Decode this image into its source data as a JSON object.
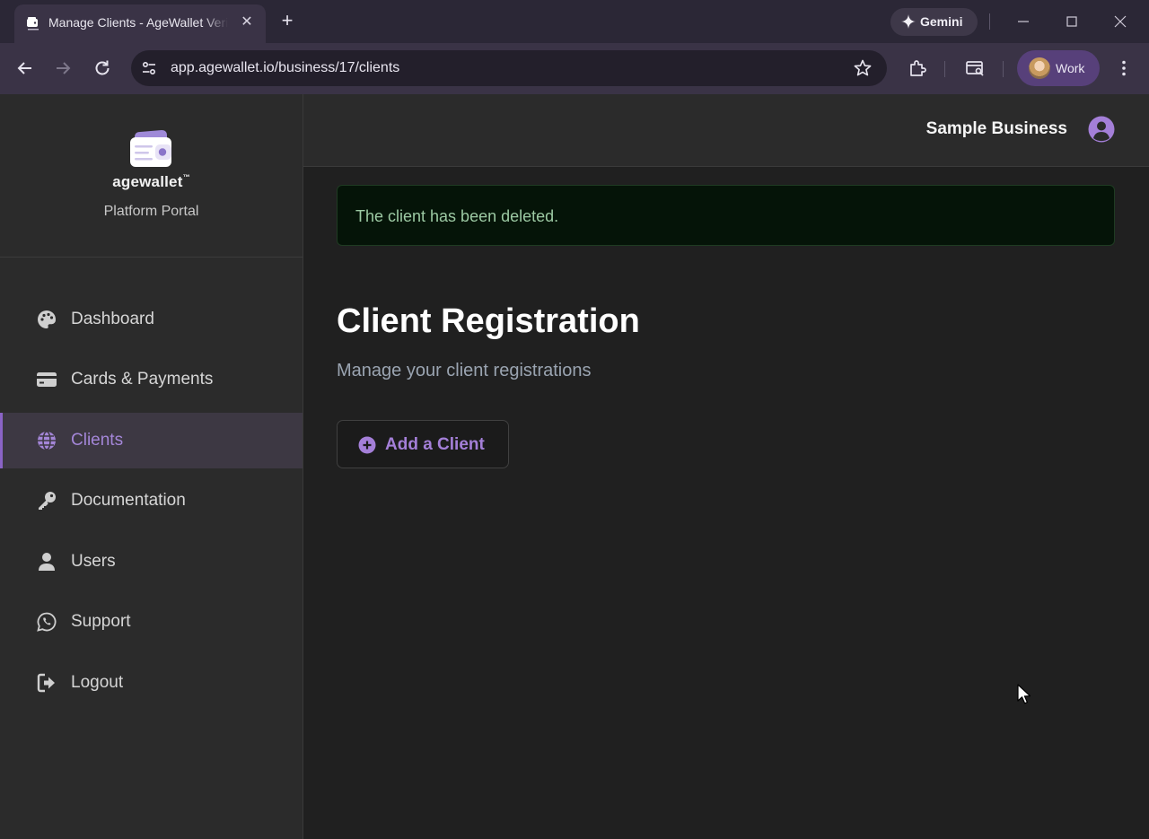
{
  "browser": {
    "tab_title": "Manage Clients - AgeWallet Verification",
    "close_tab": "✕",
    "new_tab": "+",
    "gemini_label": "Gemini",
    "url": "app.agewallet.io/business/17/clients",
    "profile_label": "Work"
  },
  "sidebar": {
    "brand_name": "agewallet",
    "brand_tm": "™",
    "brand_subtitle": "Platform Portal",
    "items": [
      {
        "label": "Dashboard",
        "icon": "palette-icon",
        "active": false
      },
      {
        "label": "Cards & Payments",
        "icon": "credit-card-icon",
        "active": false
      },
      {
        "label": "Clients",
        "icon": "globe-icon",
        "active": true
      },
      {
        "label": "Documentation",
        "icon": "key-icon",
        "active": false
      },
      {
        "label": "Users",
        "icon": "user-icon",
        "active": false
      },
      {
        "label": "Support",
        "icon": "whatsapp-icon",
        "active": false
      },
      {
        "label": "Logout",
        "icon": "sign-out-icon",
        "active": false
      }
    ]
  },
  "header": {
    "business_name": "Sample Business",
    "user_icon": "user-circle-icon"
  },
  "main": {
    "alert_text": "The client has been deleted.",
    "title": "Client Registration",
    "subtitle": "Manage your client registrations",
    "add_button_label": "Add a Client"
  },
  "colors": {
    "accent": "#a47fd8",
    "active_border": "#8a63c6",
    "success_bg": "#051408",
    "success_text": "#9cc9a3",
    "sidebar_bg": "#2b2b2b",
    "main_bg": "#202020"
  }
}
